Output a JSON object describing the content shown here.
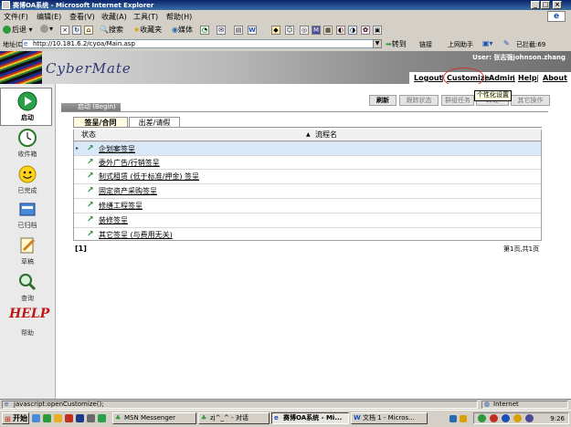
{
  "window": {
    "title": "赛博OA系统 - Microsoft Internet Explorer",
    "minimize": "_",
    "maximize": "□",
    "close": "×"
  },
  "menu": [
    "文件(F)",
    "编辑(E)",
    "查看(V)",
    "收藏(A)",
    "工具(T)",
    "帮助(H)"
  ],
  "toolbar": {
    "back": "后退",
    "search": "搜索",
    "favorites": "收藏夹",
    "media": "媒体",
    "word": "W"
  },
  "address": {
    "label": "地址(D)",
    "url": "http://10.181.6.2/cyoa/Main.asp",
    "go": "转到",
    "links": "链接",
    "internet_assist": "上网助手",
    "blocked": "已拦截:69"
  },
  "header": {
    "logo_text": "CyberMate",
    "user": "User: 张志强johnson.zhang"
  },
  "topnav": [
    {
      "label": "Logout"
    },
    {
      "label": "Customize"
    },
    {
      "label": "Admin"
    },
    {
      "label": "Help"
    },
    {
      "label": "About"
    }
  ],
  "tooltip": "个性化设置",
  "sidebar": {
    "items": [
      {
        "label": "启动",
        "icon": "play-icon"
      },
      {
        "label": "收件箱",
        "icon": "clock-icon"
      },
      {
        "label": "已完成",
        "icon": "smiley-icon"
      },
      {
        "label": "已归档",
        "icon": "archive-icon"
      },
      {
        "label": "草稿",
        "icon": "pencil-icon"
      },
      {
        "label": "查询",
        "icon": "magnifier-icon"
      },
      {
        "label": "帮助",
        "icon": "help-icon"
      }
    ],
    "help_logo": "HELP"
  },
  "panel": {
    "start_title": "启动 (Begin)",
    "actions": [
      "刷新",
      "跟踪状态",
      "群组任务",
      "转让",
      "其它操作"
    ]
  },
  "tabs": [
    "签呈/合同",
    "出差/请假"
  ],
  "table": {
    "columns": [
      "状态",
      "流程名"
    ],
    "rows": [
      "企划案签呈",
      "委外广告/行销签呈",
      "制式租赁 (低于标准/押金) 签呈",
      "固定资产采购签呈",
      "修缮工程签呈",
      "装修签呈",
      "其它签呈 (与费用无关)"
    ]
  },
  "pager": {
    "left": "[1]",
    "right": "第1页,共1页"
  },
  "statusbar": {
    "left": "javascript:openCustomize();",
    "right": "Internet"
  },
  "taskbar": {
    "start": "开始",
    "tasks": [
      "MSN Messenger",
      "zj^_^ - 对话",
      "赛博OA系统 - Mi...",
      "文档 1 - Micros..."
    ],
    "clock": "9:26"
  }
}
